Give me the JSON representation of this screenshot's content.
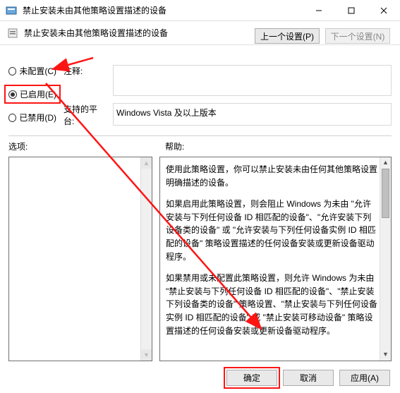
{
  "window": {
    "title": "禁止安装未由其他策略设置描述的设备"
  },
  "subheader": {
    "title": "禁止安装未由其他策略设置描述的设备"
  },
  "nav": {
    "prev": "上一个设置(P)",
    "next": "下一个设置(N)"
  },
  "radios": {
    "not_configured": "未配置(C)",
    "enabled": "已启用(E)",
    "disabled": "已禁用(D)"
  },
  "fields": {
    "comment_label": "注释:",
    "comment_value": "",
    "platform_label": "支持的平台:",
    "platform_value": "Windows Vista 及以上版本"
  },
  "sections": {
    "options": "选项:",
    "help": "帮助:"
  },
  "help": {
    "p1": "使用此策略设置，你可以禁止安装未由任何其他策略设置明确描述的设备。",
    "p2": "如果启用此策略设置，则会阻止 Windows 为未由 \"允许安装与下列任何设备 ID 相匹配的设备\"、\"允许安装下列设备类的设备\" 或 \"允许安装与下列任何设备实例 ID 相匹配的设备\" 策略设置描述的任何设备安装或更新设备驱动程序。",
    "p3": "如果禁用或未配置此策略设置，则允许 Windows 为未由 \"禁止安装与下列任何设备 ID 相匹配的设备\"、\"禁止安装下列设备类的设备\" 策略设置、\"禁止安装与下列任何设备实例 ID 相匹配的设备\" 或 \"禁止安装可移动设备\" 策略设置描述的任何设备安装或更新设备驱动程序。"
  },
  "buttons": {
    "ok": "确定",
    "cancel": "取消",
    "apply": "应用(A)"
  },
  "selected_radio": "enabled"
}
